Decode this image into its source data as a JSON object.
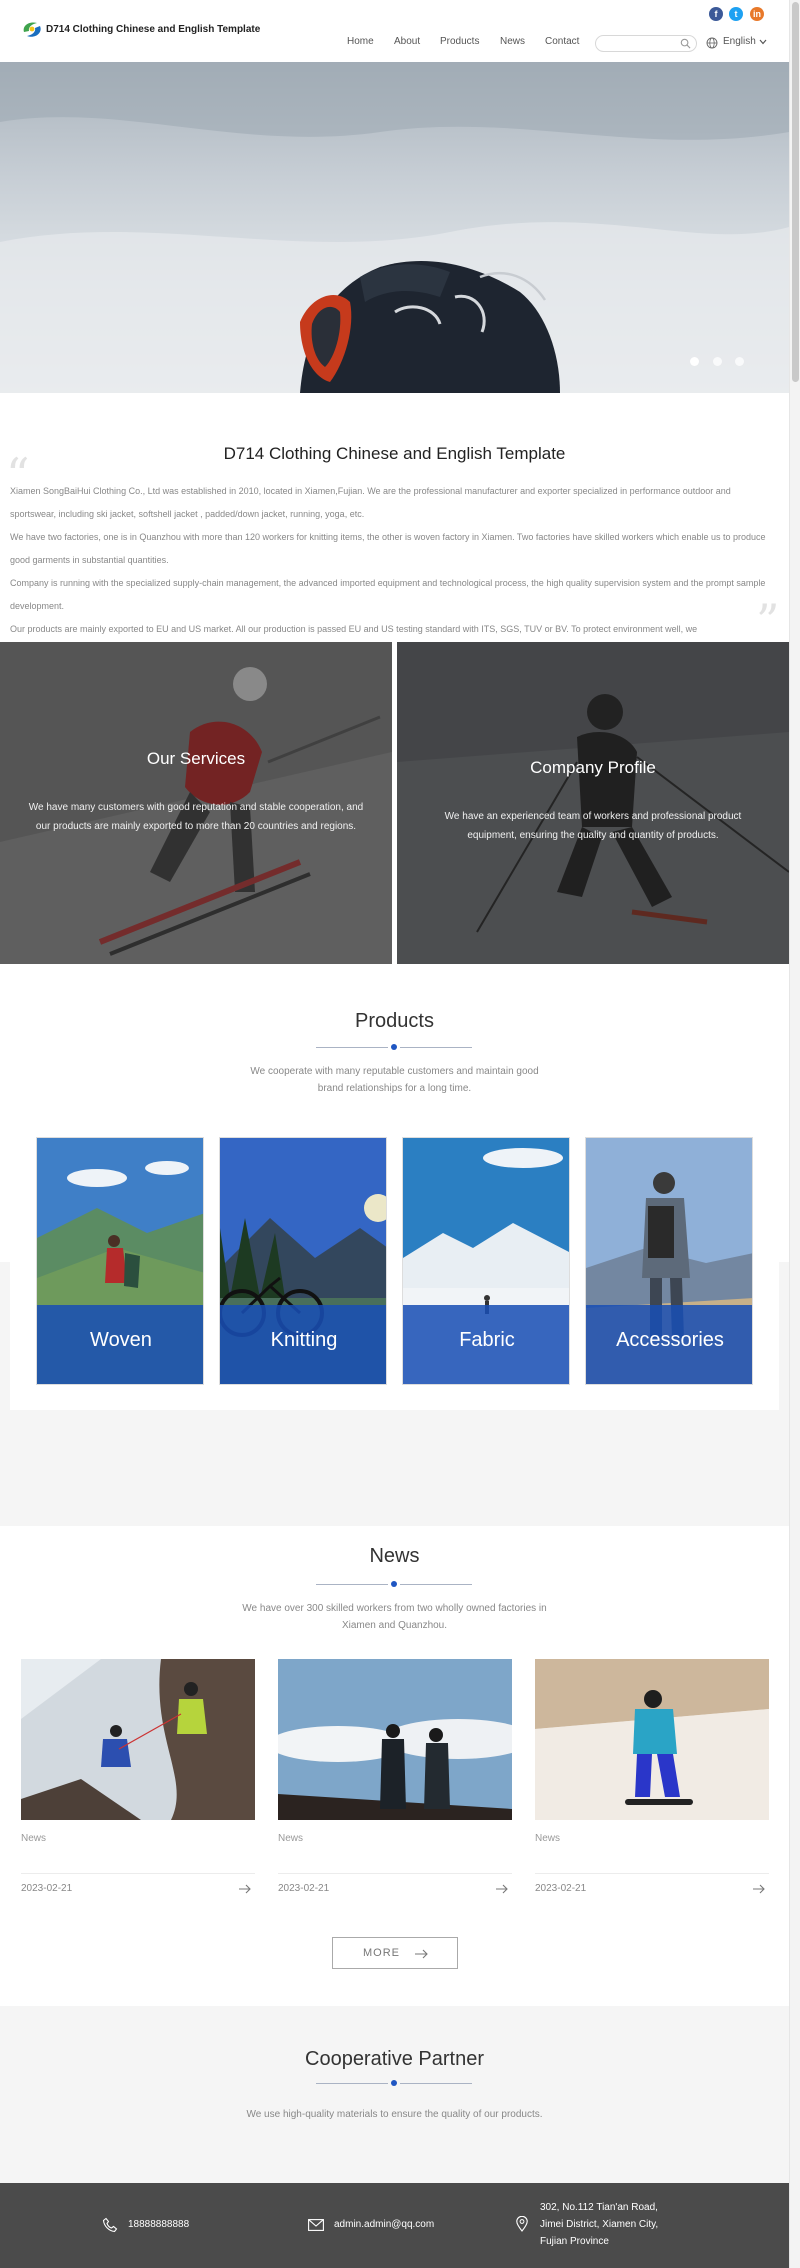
{
  "header": {
    "logo_text": "D714 Clothing Chinese and English Template",
    "social": [
      {
        "name": "facebook",
        "glyph": "f",
        "color": "#3b5998"
      },
      {
        "name": "twitter",
        "glyph": "t",
        "color": "#1da1f2"
      },
      {
        "name": "linkedin",
        "glyph": "in",
        "color": "#e8792a"
      }
    ],
    "nav": [
      "Home",
      "About",
      "Products",
      "News",
      "Contact"
    ],
    "search_placeholder": "",
    "language": "English"
  },
  "hero": {
    "slides": 3,
    "active_slide": 1
  },
  "intro": {
    "title": "D714 Clothing Chinese and English Template",
    "paragraphs": [
      "Xiamen SongBaiHui Clothing Co., Ltd was established in 2010, located in Xiamen,Fujian. We are the professional manufacturer and exporter specialized in performance outdoor and sportswear, including ski jacket, softshell jacket , padded/down jacket, running, yoga, etc.",
      "We have two factories, one is in Quanzhou with more than 120 workers for knitting items, the other is woven factory in Xiamen. Two factories have skilled workers which enable us to produce good garments in substantial quantities.",
      "Company is running with the specialized supply-chain management, the advanced imported equipment and technological process, the high quality supervision system and the prompt sample development.",
      "Our products are mainly exported to EU and US market. All our production is passed EU and US testing standard with ITS, SGS, TUV or BV. To protect environment well, we"
    ]
  },
  "panels": [
    {
      "title": "Our Services",
      "text": "We have many customers with good reputation and stable cooperation, and our products are mainly exported to more than 20 countries and regions."
    },
    {
      "title": "Company Profile",
      "text": "We have an experienced team of workers and professional product equipment, ensuring the quality and quantity of products."
    }
  ],
  "products": {
    "title": "Products",
    "subtitle": "We cooperate with many reputable customers and maintain good brand relationships for a long time.",
    "items": [
      "Woven",
      "Knitting",
      "Fabric",
      "Accessories"
    ]
  },
  "news": {
    "title": "News",
    "subtitle": "We have over 300 skilled workers from two wholly owned factories in Xiamen and Quanzhou.",
    "items": [
      {
        "category": "News",
        "date": "2023-02-21"
      },
      {
        "category": "News",
        "date": "2023-02-21"
      },
      {
        "category": "News",
        "date": "2023-02-21"
      }
    ],
    "more_label": "MORE"
  },
  "partner": {
    "title": "Cooperative Partner",
    "subtitle": "We use high-quality materials to ensure the quality of our products."
  },
  "footer": {
    "phone": "18888888888",
    "email": "admin.admin@qq.com",
    "address": [
      "302, No.112 Tian'an Road,",
      "Jimei District, Xiamen City,",
      "Fujian Province"
    ]
  },
  "colors": {
    "accent": "#1f56c2",
    "footer_bg": "#4b4b4b",
    "section_bg": "#f5f5f5"
  }
}
